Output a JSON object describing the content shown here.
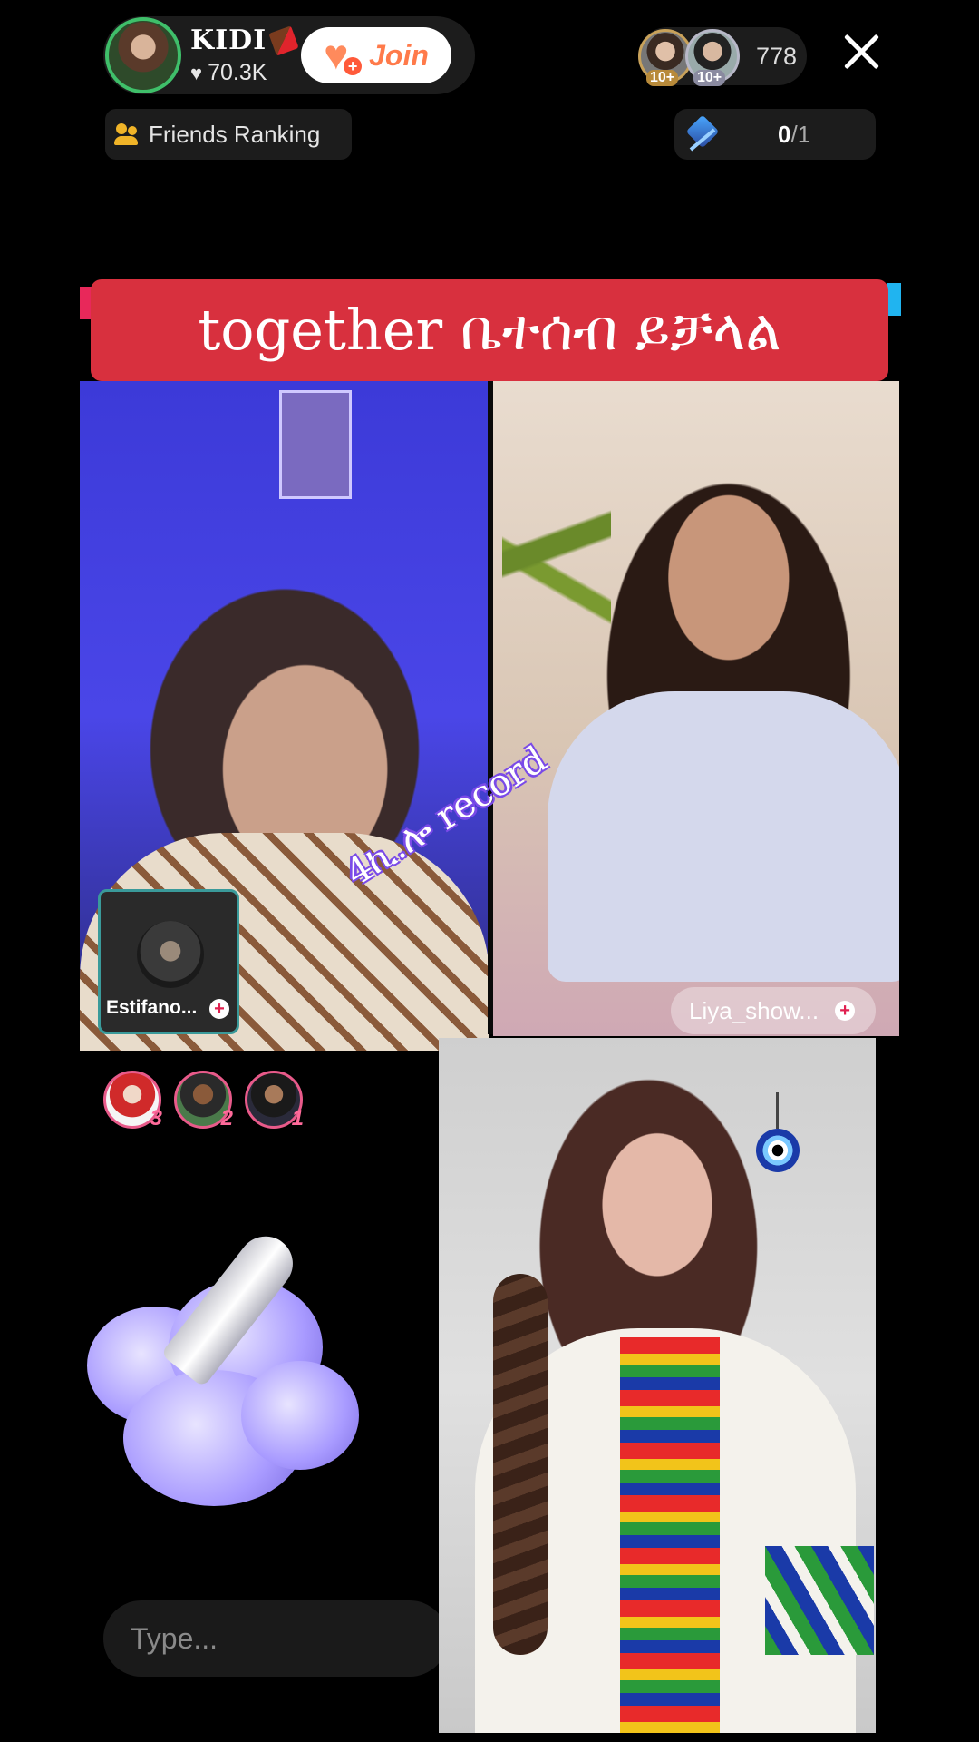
{
  "host": {
    "name": "KIDI",
    "likes": "70.3K",
    "join_label": "Join"
  },
  "viewers": {
    "badges": [
      "10+",
      "10+"
    ],
    "count": "778"
  },
  "friends_ranking_label": "Friends Ranking",
  "goal": {
    "current": "0",
    "total": "/1"
  },
  "caption": "together ቤተሰብ ይቻላል",
  "battle": {
    "guest_name": "Estifano...",
    "opponent_name": "Liya_show..."
  },
  "watermark": "4ኪ.ሎ record",
  "supporters": [
    {
      "rank": "3"
    },
    {
      "rank": "2"
    },
    {
      "rank": "1"
    }
  ],
  "chat": {
    "placeholder": "Type..."
  },
  "colors": {
    "caption_bg": "#d8303e",
    "join_text": "#ff7a4a",
    "host_ring": "#3fbf6a",
    "accent_pink": "#e8285a",
    "accent_blue": "#20b4f0"
  }
}
